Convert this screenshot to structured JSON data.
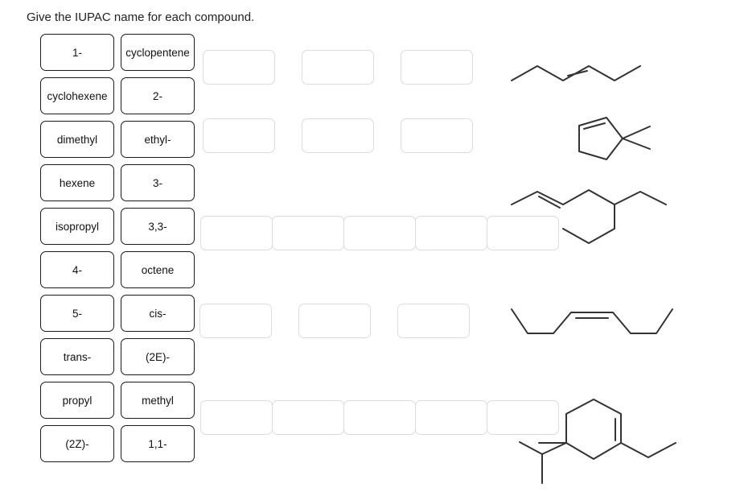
{
  "prompt": "Give the IUPAC name for each compound.",
  "wordbank": {
    "rows": [
      [
        {
          "label": "1-"
        },
        {
          "label": "cyclopentene"
        }
      ],
      [
        {
          "label": "cyclohexene"
        },
        {
          "label": "2-"
        }
      ],
      [
        {
          "label": "dimethyl"
        },
        {
          "label": "ethyl-"
        }
      ],
      [
        {
          "label": "hexene"
        },
        {
          "label": "3-"
        }
      ],
      [
        {
          "label": "isopropyl"
        },
        {
          "label": "3,3-"
        }
      ],
      [
        {
          "label": "4-"
        },
        {
          "label": "octene"
        }
      ],
      [
        {
          "label": "5-"
        },
        {
          "label": "cis-"
        }
      ],
      [
        {
          "label": "trans-"
        },
        {
          "label": "(2E)-"
        }
      ],
      [
        {
          "label": "propyl"
        },
        {
          "label": "methyl"
        }
      ],
      [
        {
          "label": "(2Z)-"
        },
        {
          "label": "1,1-"
        }
      ]
    ]
  },
  "answer_rows": [
    {
      "id": "answer-row-1",
      "slots": 3,
      "layout": "spaced",
      "value": [
        "",
        "",
        ""
      ]
    },
    {
      "id": "answer-row-2",
      "slots": 3,
      "layout": "spaced",
      "value": [
        "",
        "",
        ""
      ]
    },
    {
      "id": "answer-row-3",
      "slots": 5,
      "layout": "joined",
      "value": [
        "",
        "",
        "",
        "",
        ""
      ]
    },
    {
      "id": "answer-row-4",
      "slots": 3,
      "layout": "spaced",
      "value": [
        "",
        "",
        ""
      ]
    },
    {
      "id": "answer-row-5",
      "slots": 5,
      "layout": "joined",
      "value": [
        "",
        "",
        "",
        "",
        ""
      ]
    }
  ],
  "structures": [
    {
      "id": "structure-1",
      "name": "trans-alkene-chain"
    },
    {
      "id": "structure-2",
      "name": "gem-dimethyl-cyclopentene"
    },
    {
      "id": "structure-3",
      "name": "branched-alkene-chain"
    },
    {
      "id": "structure-4",
      "name": "cis-alkene-chain"
    },
    {
      "id": "structure-5",
      "name": "substituted-cyclohexene"
    }
  ],
  "colors": {
    "tile_border": "#1b1b1b",
    "dropzone_border": "#dcdcdc",
    "bond_stroke": "#333333",
    "text": "#222222",
    "background": "#ffffff"
  }
}
